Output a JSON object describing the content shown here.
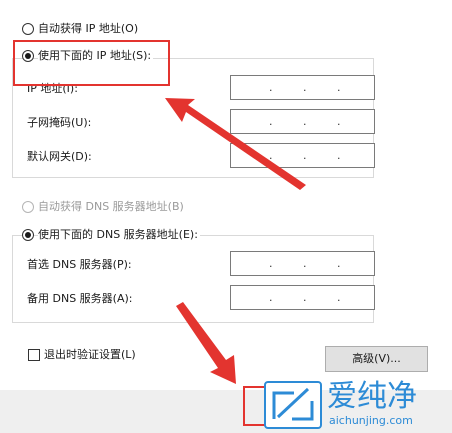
{
  "ip_section": {
    "auto_ip_label": "自动获得 IP 地址(O)",
    "manual_ip_label": "使用下面的 IP 地址(S):",
    "fields": [
      {
        "label": "IP 地址(I):",
        "value": ".        .        ."
      },
      {
        "label": "子网掩码(U):",
        "value": ".        .        ."
      },
      {
        "label": "默认网关(D):",
        "value": ".        .        ."
      }
    ]
  },
  "dns_section": {
    "auto_dns_label": "自动获得 DNS 服务器地址(B)",
    "manual_dns_label": "使用下面的 DNS 服务器地址(E):",
    "fields": [
      {
        "label": "首选 DNS 服务器(P):",
        "value": ".        .        ."
      },
      {
        "label": "备用 DNS 服务器(A):",
        "value": ".        .        ."
      }
    ]
  },
  "validate_label": "退出时验证设置(L)",
  "advanced_button": "高级(V)...",
  "watermark": {
    "brand": "爱纯净",
    "url": "aichunjing.com"
  },
  "colors": {
    "annotation_red": "#e3342f",
    "brand_blue": "#2d8bd6"
  }
}
